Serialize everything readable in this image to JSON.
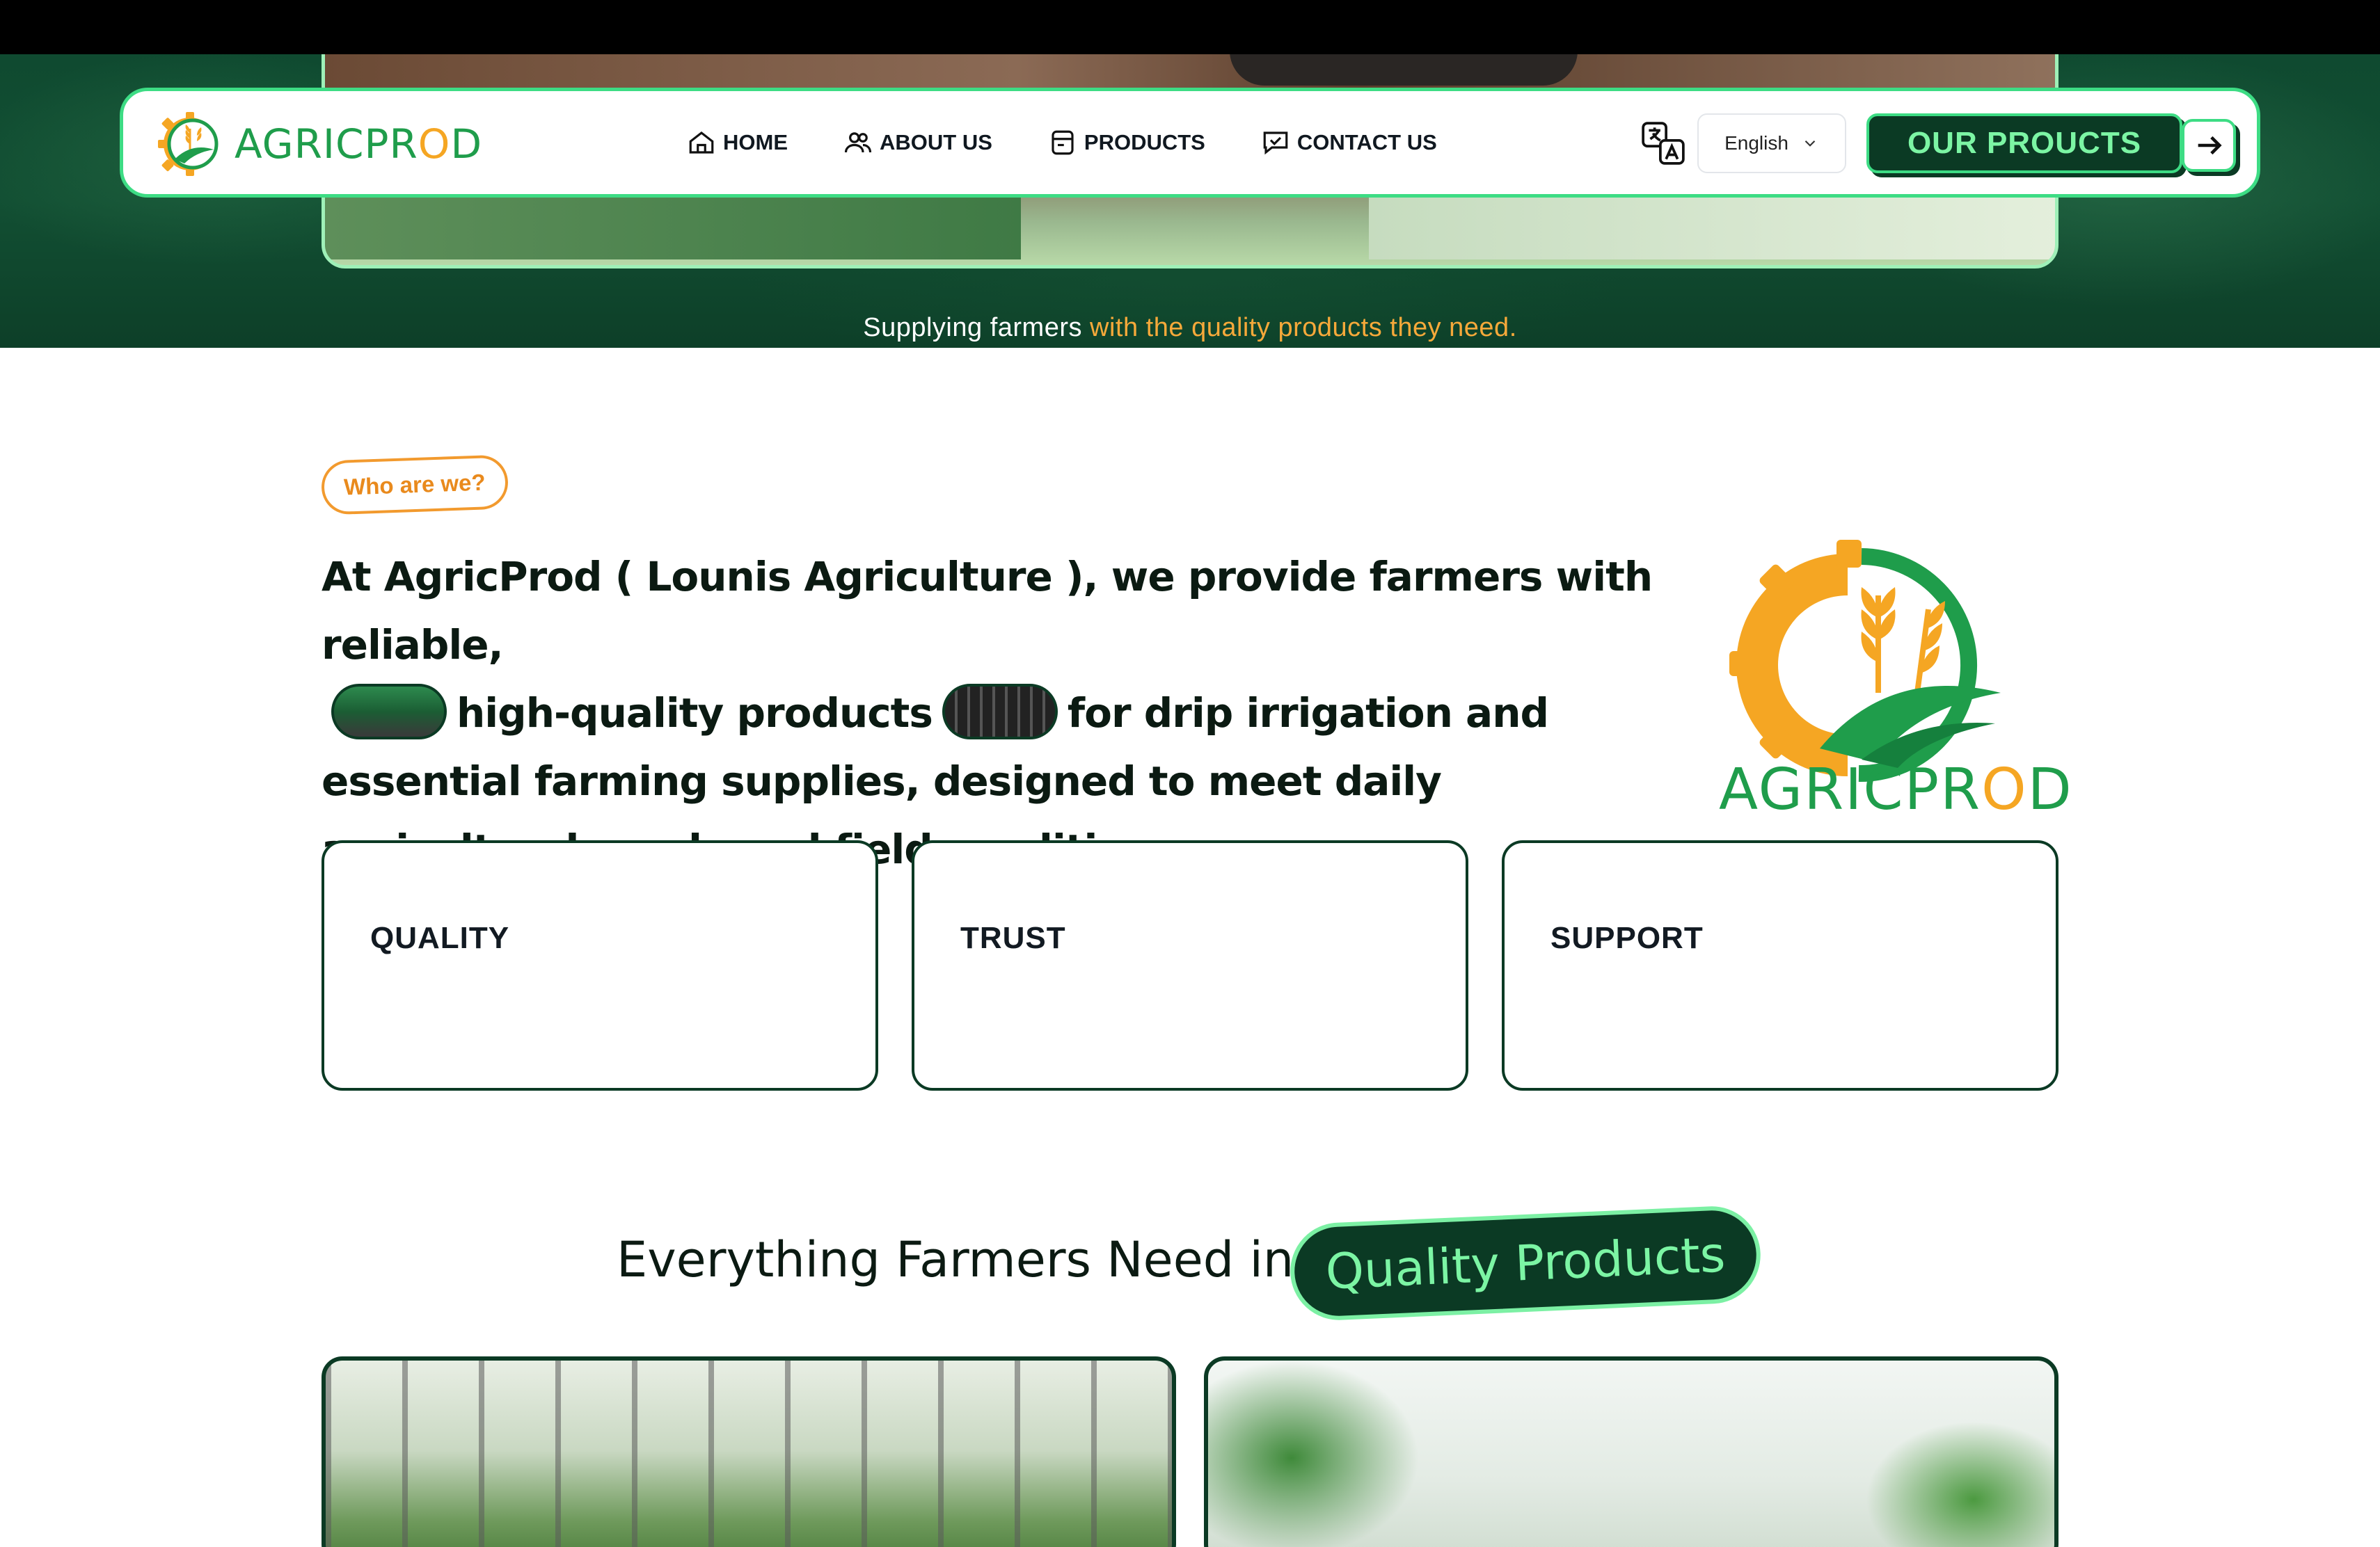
{
  "colors": {
    "brand_green": "#1f9d4b",
    "brand_orange": "#f5a623",
    "dark_green": "#0b3a24",
    "mint": "#7cf5a4"
  },
  "brand": {
    "name_part1": "AGRIC",
    "name_part2": "PR",
    "name_part3": "O",
    "name_part4": "D",
    "logo_icon": "gear-wheat-leaf-logo"
  },
  "nav": {
    "links": [
      {
        "label": "HOME",
        "icon": "home-icon"
      },
      {
        "label": "ABOUT US",
        "icon": "users-icon"
      },
      {
        "label": "PRODUCTS",
        "icon": "box-icon"
      },
      {
        "label": "CONTACT US",
        "icon": "chat-icon"
      }
    ],
    "language_icon": "translate-icon",
    "language_selected": "English",
    "cta_label": "OUR PROUCTS",
    "cta_arrow_icon": "arrow-right-icon"
  },
  "hero": {
    "tagline_white": "Supplying farmers ",
    "tagline_accent": "with the quality products they need."
  },
  "about": {
    "pill": "Who are we?",
    "text_part1": "At AgricProd ( Lounis Agriculture ), we provide farmers with reliable,",
    "text_part2": "high-quality products",
    "text_part3": "for drip irrigation and essential farming supplies, designed to meet daily agricultural needs and field conditions."
  },
  "values": [
    {
      "title": "QUALITY"
    },
    {
      "title": "TRUST"
    },
    {
      "title": "SUPPORT"
    }
  ],
  "products_section": {
    "heading": "Everything Farmers Need in",
    "highlight": "Quality Products"
  }
}
